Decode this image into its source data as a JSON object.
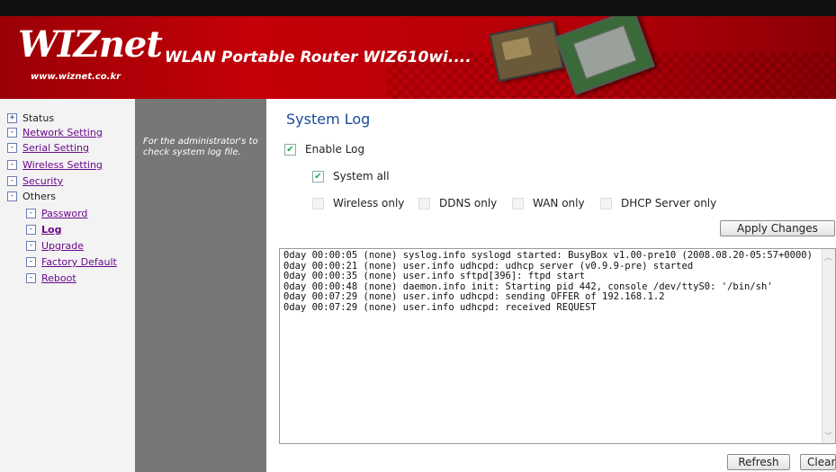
{
  "banner": {
    "logo": "WIZnet",
    "logo_url": "www.wiznet.co.kr",
    "title": "WLAN Portable Router WIZ610wi...."
  },
  "sidebar": {
    "items": [
      {
        "icon": "+",
        "label": "Status"
      },
      {
        "icon": "-",
        "label": "Network Setting"
      },
      {
        "icon": "-",
        "label": "Serial Setting"
      },
      {
        "icon": "-",
        "label": "Wireless Setting"
      },
      {
        "icon": "-",
        "label": "Security"
      },
      {
        "icon": "-",
        "label": "Others"
      },
      {
        "icon": "-",
        "label": "Password"
      },
      {
        "icon": "-",
        "label": "Log"
      },
      {
        "icon": "-",
        "label": "Upgrade"
      },
      {
        "icon": "-",
        "label": "Factory Default"
      },
      {
        "icon": "-",
        "label": "Reboot"
      }
    ]
  },
  "description": "For the administrator's to check system log file.",
  "main": {
    "title": "System Log",
    "enable_log": {
      "label": "Enable Log",
      "checked": true
    },
    "system_all": {
      "label": "System all",
      "checked": true
    },
    "filters": [
      {
        "label": "Wireless only",
        "checked": false
      },
      {
        "label": "DDNS only",
        "checked": false
      },
      {
        "label": "WAN only",
        "checked": false
      },
      {
        "label": "DHCP Server only",
        "checked": false
      }
    ],
    "apply_label": "Apply Changes",
    "log_text": "0day 00:00:05 (none) syslog.info syslogd started: BusyBox v1.00-pre10 (2008.08.20-05:57+0000)\n0day 00:00:21 (none) user.info udhcpd: udhcp server (v0.9.9-pre) started\n0day 00:00:35 (none) user.info sftpd[396]: ftpd start\n0day 00:00:48 (none) daemon.info init: Starting pid 442, console /dev/ttyS0: '/bin/sh'\n0day 00:07:29 (none) user.info udhcpd: sending OFFER of 192.168.1.2\n0day 00:07:29 (none) user.info udhcpd: received REQUEST",
    "refresh_label": "Refresh",
    "clear_label": "Clear"
  }
}
